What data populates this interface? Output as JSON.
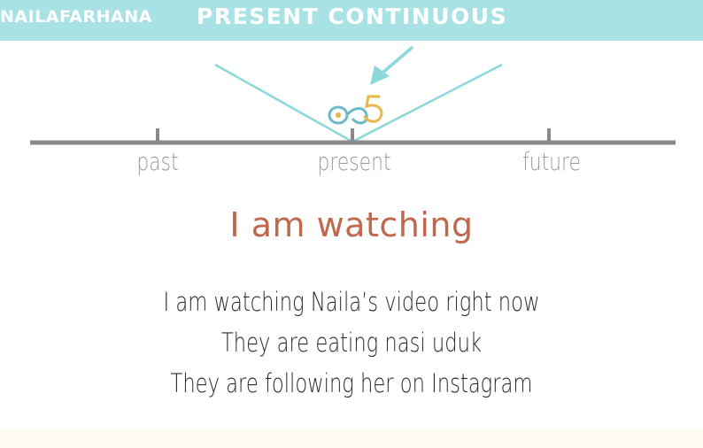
{
  "banner": {
    "brand": "NAILAFARHANA",
    "title": "PRESENT CONTINUOUS",
    "color": "#a9e2e4"
  },
  "timeline": {
    "labels": [
      "past",
      "present",
      "future"
    ],
    "line_color": "#888888",
    "v_color": "#8ad8da",
    "icons": [
      "arrow-icon",
      "infinity-icon",
      "number-five-icon"
    ]
  },
  "headline": {
    "text": "I am watching",
    "color": "#c0684e"
  },
  "examples": [
    "I am watching Naila’s video right now",
    "They are eating nasi uduk",
    "They are following her on Instagram"
  ]
}
